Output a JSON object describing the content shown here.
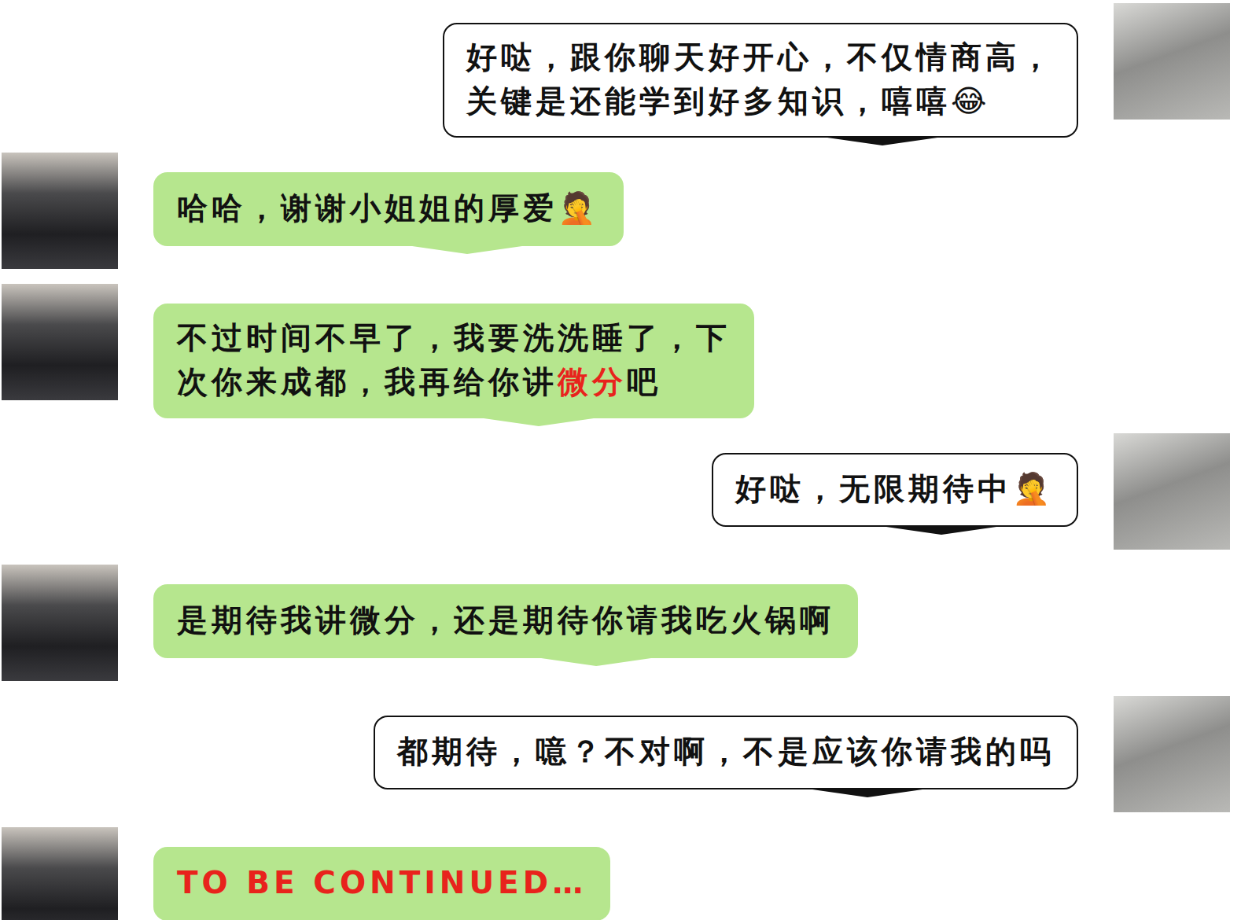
{
  "messages": [
    {
      "side": "right",
      "lines": [
        [
          {
            "text": "好哒，跟你聊天好开心，不仅情商高，",
            "red": false
          }
        ],
        [
          {
            "text": "关键是还能学到好多知识，嘻嘻😂",
            "red": false
          }
        ]
      ]
    },
    {
      "side": "left",
      "lines": [
        [
          {
            "text": "哈哈，谢谢小姐姐的厚爱🤦",
            "red": false
          }
        ]
      ]
    },
    {
      "side": "left",
      "lines": [
        [
          {
            "text": "不过时间不早了，我要洗洗睡了，下",
            "red": false
          }
        ],
        [
          {
            "text": "次你来成都，我再给你讲",
            "red": false
          },
          {
            "text": "微分",
            "red": true
          },
          {
            "text": "吧",
            "red": false
          }
        ]
      ]
    },
    {
      "side": "right",
      "lines": [
        [
          {
            "text": "好哒，无限期待中🤦",
            "red": false
          }
        ]
      ]
    },
    {
      "side": "left",
      "lines": [
        [
          {
            "text": "是期待我讲微分，还是期待你请我吃火锅啊",
            "red": false
          }
        ]
      ]
    },
    {
      "side": "right",
      "lines": [
        [
          {
            "text": "都期待，噫？不对啊，不是应该你请我的吗",
            "red": false
          }
        ]
      ]
    },
    {
      "side": "left",
      "lines": [
        [
          {
            "text": "TO BE CONTINUED…",
            "red": true
          }
        ]
      ]
    }
  ]
}
